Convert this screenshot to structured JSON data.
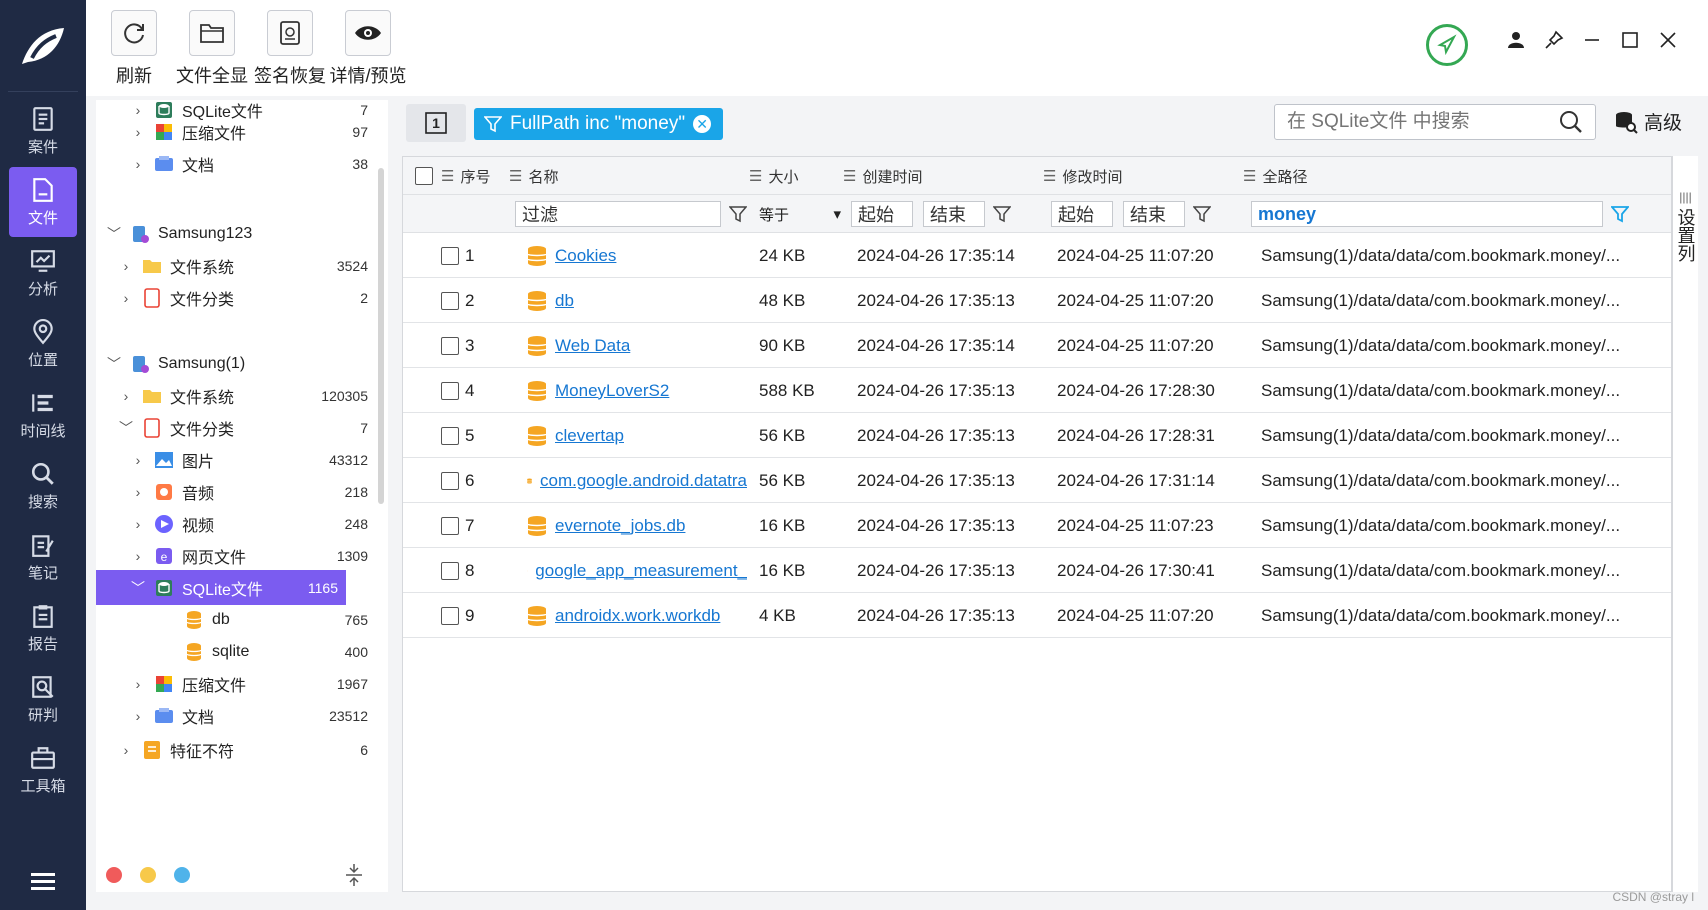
{
  "toolbar": {
    "refresh": "刷新",
    "show_all": "文件全显",
    "sig_restore": "签名恢复",
    "detail": "详情/预览"
  },
  "nav": [
    {
      "label": "案件",
      "icon": "case-icon"
    },
    {
      "label": "文件",
      "icon": "file-icon",
      "active": true
    },
    {
      "label": "分析",
      "icon": "analysis-icon"
    },
    {
      "label": "位置",
      "icon": "location-icon"
    },
    {
      "label": "时间线",
      "icon": "timeline-icon"
    },
    {
      "label": "搜索",
      "icon": "search-icon"
    },
    {
      "label": "笔记",
      "icon": "note-icon"
    },
    {
      "label": "报告",
      "icon": "report-icon"
    },
    {
      "label": "研判",
      "icon": "judge-icon"
    },
    {
      "label": "工具箱",
      "icon": "toolbox-icon"
    }
  ],
  "tree": [
    {
      "label": "SQLite文件",
      "count": "7",
      "level": 2,
      "icon": "sqlite"
    },
    {
      "label": "压缩文件",
      "count": "97",
      "level": 2,
      "icon": "zip"
    },
    {
      "label": "文档",
      "count": "38",
      "level": 2,
      "icon": "doc"
    },
    {
      "label": "Samsung123",
      "count": "",
      "level": 0,
      "icon": "device",
      "expanded": true
    },
    {
      "label": "文件系统",
      "count": "3524",
      "level": 1,
      "icon": "folder"
    },
    {
      "label": "文件分类",
      "count": "2",
      "level": 1,
      "icon": "category"
    },
    {
      "label": "Samsung(1)",
      "count": "",
      "level": 0,
      "icon": "device",
      "expanded": true
    },
    {
      "label": "文件系统",
      "count": "120305",
      "level": 1,
      "icon": "folder"
    },
    {
      "label": "文件分类",
      "count": "7",
      "level": 1,
      "icon": "category",
      "expanded": true
    },
    {
      "label": "图片",
      "count": "43312",
      "level": 2,
      "icon": "image"
    },
    {
      "label": "音频",
      "count": "218",
      "level": 2,
      "icon": "audio"
    },
    {
      "label": "视频",
      "count": "248",
      "level": 2,
      "icon": "video"
    },
    {
      "label": "网页文件",
      "count": "1309",
      "level": 2,
      "icon": "web"
    },
    {
      "label": "SQLite文件",
      "count": "1165",
      "level": 2,
      "icon": "sqlite",
      "selected": true,
      "expanded": true
    },
    {
      "label": "db",
      "count": "765",
      "level": 3,
      "icon": "db"
    },
    {
      "label": "sqlite",
      "count": "400",
      "level": 3,
      "icon": "db"
    },
    {
      "label": "压缩文件",
      "count": "1967",
      "level": 2,
      "icon": "zip"
    },
    {
      "label": "文档",
      "count": "23512",
      "level": 2,
      "icon": "doc"
    },
    {
      "label": "特征不符",
      "count": "6",
      "level": 1,
      "icon": "mismatch"
    }
  ],
  "filter": {
    "page_button": "1",
    "chip": "FullPath inc \"money\"",
    "search_placeholder": "在 SQLite文件 中搜索",
    "advanced": "高级"
  },
  "columns": {
    "seq": "序号",
    "name": "名称",
    "size": "大小",
    "created": "创建时间",
    "modified": "修改时间",
    "path": "全路径"
  },
  "filters_row": {
    "name": "过滤",
    "size_op": "等于",
    "start": "起始",
    "end": "结束",
    "path": "money"
  },
  "settings_col": "设置列",
  "rows": [
    {
      "seq": "1",
      "name": "Cookies",
      "size": "24 KB",
      "created": "2024-04-26 17:35:14",
      "modified": "2024-04-25 11:07:20",
      "path": "Samsung(1)/data/data/com.bookmark.money/..."
    },
    {
      "seq": "2",
      "name": "db",
      "size": "48 KB",
      "created": "2024-04-26 17:35:13",
      "modified": "2024-04-25 11:07:20",
      "path": "Samsung(1)/data/data/com.bookmark.money/..."
    },
    {
      "seq": "3",
      "name": "Web Data",
      "size": "90 KB",
      "created": "2024-04-26 17:35:14",
      "modified": "2024-04-25 11:07:20",
      "path": "Samsung(1)/data/data/com.bookmark.money/..."
    },
    {
      "seq": "4",
      "name": "MoneyLoverS2",
      "size": "588 KB",
      "created": "2024-04-26 17:35:13",
      "modified": "2024-04-26 17:28:30",
      "path": "Samsung(1)/data/data/com.bookmark.money/..."
    },
    {
      "seq": "5",
      "name": "clevertap",
      "size": "56 KB",
      "created": "2024-04-26 17:35:13",
      "modified": "2024-04-26 17:28:31",
      "path": "Samsung(1)/data/data/com.bookmark.money/..."
    },
    {
      "seq": "6",
      "name": "com.google.android.datatra",
      "size": "56 KB",
      "created": "2024-04-26 17:35:13",
      "modified": "2024-04-26 17:31:14",
      "path": "Samsung(1)/data/data/com.bookmark.money/..."
    },
    {
      "seq": "7",
      "name": "evernote_jobs.db",
      "size": "16 KB",
      "created": "2024-04-26 17:35:13",
      "modified": "2024-04-25 11:07:23",
      "path": "Samsung(1)/data/data/com.bookmark.money/..."
    },
    {
      "seq": "8",
      "name": "google_app_measurement_",
      "size": "16 KB",
      "created": "2024-04-26 17:35:13",
      "modified": "2024-04-26 17:30:41",
      "path": "Samsung(1)/data/data/com.bookmark.money/..."
    },
    {
      "seq": "9",
      "name": "androidx.work.workdb",
      "size": "4 KB",
      "created": "2024-04-26 17:35:13",
      "modified": "2024-04-25 11:07:20",
      "path": "Samsung(1)/data/data/com.bookmark.money/..."
    }
  ],
  "watermark": "CSDN @stray l",
  "colors": {
    "accent": "#7b5cf0",
    "chip": "#1aa5e8",
    "rail": "#1f2a44",
    "link": "#1677d2",
    "ok": "#34a853"
  }
}
